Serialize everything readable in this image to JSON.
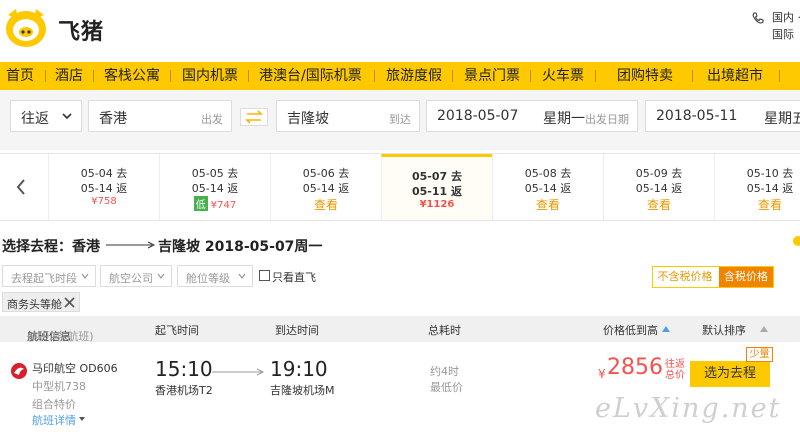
{
  "brand": {
    "name": "飞猪",
    "logo_icon": "pig-logo-icon",
    "color": "#ffc900"
  },
  "header_right": {
    "line1": "国内 ·",
    "line2": "国际"
  },
  "nav": [
    "首页",
    "酒店",
    "客栈公寓",
    "国内机票",
    "港澳台/国际机票",
    "旅游度假",
    "景点门票",
    "火车票",
    "团购特卖",
    "出境超市"
  ],
  "search": {
    "trip_type": "往返",
    "from": "香港",
    "from_suffix": "出发",
    "to": "吉隆坡",
    "to_suffix": "到达",
    "depart_date": "2018-05-07",
    "depart_weekday": "星期一",
    "depart_label": "出发日期",
    "return_date": "2018-05-11",
    "return_weekday": "星期五"
  },
  "date_options": [
    {
      "go": "05-04 去",
      "back": "05-14 返",
      "price": "¥758"
    },
    {
      "go": "05-05 去",
      "back": "05-14 返",
      "price": "¥747",
      "tag": "低"
    },
    {
      "go": "05-06 去",
      "back": "05-14 返",
      "link": "查看"
    },
    {
      "go": "05-07 去",
      "back": "05-11 返",
      "price": "¥1126",
      "selected": true
    },
    {
      "go": "05-08 去",
      "back": "05-14 返",
      "link": "查看"
    },
    {
      "go": "05-09 去",
      "back": "05-14 返",
      "link": "查看"
    },
    {
      "go": "05-10 去",
      "back": "05-14 返",
      "link": "查看"
    }
  ],
  "route": {
    "label": "选择去程：香港",
    "dest": "吉隆坡",
    "date": "2018-05-07周一"
  },
  "tax_toggle": {
    "excl": "不含税价格",
    "incl": "含税价格"
  },
  "filters": [
    "去程起飞时段",
    "航空公司",
    "舱位等级"
  ],
  "direct_only_label": "只看直飞",
  "active_filter": "商务头等舱",
  "table": {
    "col_flight": "航班信息",
    "col_flight_count": "(共92条航班)",
    "col_dep": "起飞时间",
    "col_arr": "到达时间",
    "col_dur": "总耗时",
    "col_price": "价格低到高",
    "col_sort": "默认排序"
  },
  "flight": {
    "airline": "马印航空 OD606",
    "aircraft": "中型机738",
    "combo": "组合特价",
    "detail": "航班详情",
    "dep_time": "15:10",
    "arr_time": "19:10",
    "dep_airport": "香港机场T2",
    "arr_airport": "吉隆坡机场M",
    "duration": "约4时",
    "lowest": "最低价",
    "currency": "¥",
    "price": "2856",
    "note": "往返总价",
    "book": "选为去程",
    "few": "少量"
  },
  "watermark": "eLvXing.net"
}
